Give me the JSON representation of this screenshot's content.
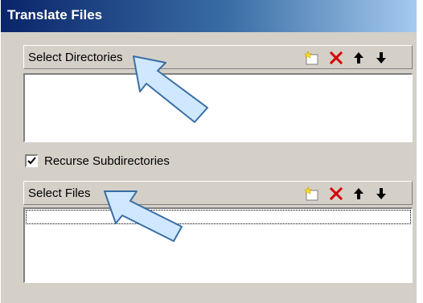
{
  "window": {
    "title": "Translate Files"
  },
  "directories": {
    "header_label": "Select Directories",
    "items": []
  },
  "recurse": {
    "label": "Recurse Subdirectories",
    "checked": true
  },
  "files": {
    "header_label": "Select Files",
    "items": []
  },
  "toolbar_icons": [
    "new-item-icon",
    "delete-icon",
    "move-up-icon",
    "move-down-icon"
  ],
  "colors": {
    "title_gradient_start": "#0a246a",
    "title_gradient_end": "#a6caf0",
    "delete_red": "#d40000",
    "callout_fill": "#cfe8ff",
    "callout_stroke": "#3a6ea5"
  }
}
